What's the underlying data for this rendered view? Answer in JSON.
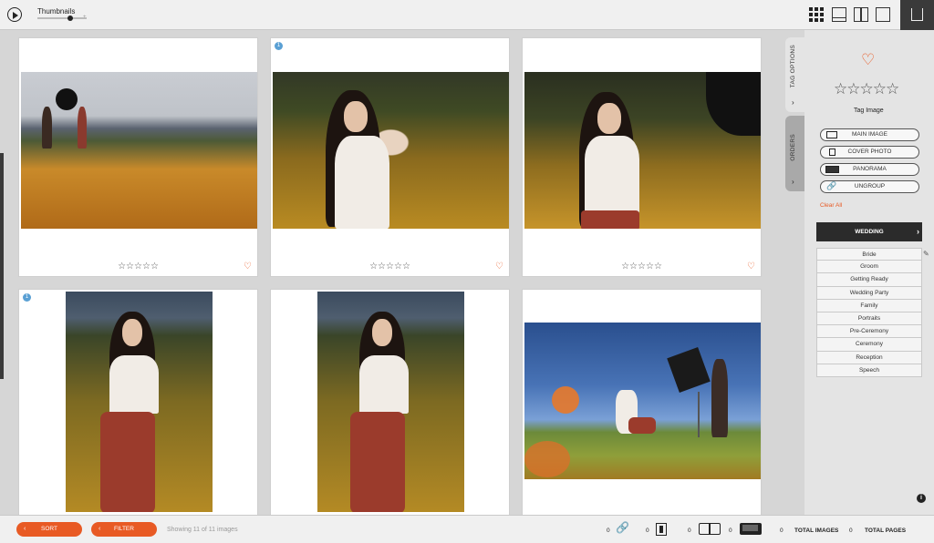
{
  "topbar": {
    "thumbnails_label": "Thumbnails",
    "slider_minus": "−",
    "slider_plus": "+",
    "view_icons": [
      "grid-icon",
      "filmstrip-icon",
      "compare-icon",
      "single-view-icon"
    ],
    "right_icon": "export-icon"
  },
  "grid": {
    "cards": [
      {
        "badge": "",
        "stars": "☆☆☆☆☆",
        "heart": "♡",
        "photo": "field-with-lighting-setup"
      },
      {
        "badge": "1",
        "stars": "☆☆☆☆☆",
        "heart": "♡",
        "photo": "portrait-in-flower-field"
      },
      {
        "badge": "",
        "stars": "☆☆☆☆☆",
        "heart": "♡",
        "photo": "portrait-with-softbox"
      },
      {
        "badge": "1",
        "stars": "",
        "heart": "",
        "photo": "full-length-portrait"
      },
      {
        "badge": "",
        "stars": "",
        "heart": "",
        "photo": "full-length-portrait"
      },
      {
        "badge": "",
        "stars": "",
        "heart": "",
        "photo": "behind-the-scenes-shot"
      }
    ]
  },
  "right_panel": {
    "tabs": [
      {
        "label": "TAG OPTIONS",
        "arrow": "›"
      },
      {
        "label": "ORDERS",
        "arrow": "›"
      }
    ],
    "heart": "♡",
    "stars": "☆☆☆☆☆",
    "tag_image_label": "Tag Image",
    "buttons": [
      {
        "label": "MAIN IMAGE",
        "icon": "main-image-icon"
      },
      {
        "label": "COVER PHOTO",
        "icon": "cover-photo-icon"
      },
      {
        "label": "PANORAMA",
        "icon": "panorama-icon"
      },
      {
        "label": "UNGROUP",
        "icon": "link-icon"
      }
    ],
    "clear_all": "Clear All",
    "category": "WEDDING",
    "category_arrow": "›",
    "tags": [
      "Bride",
      "Groom",
      "Getting Ready",
      "Wedding Party",
      "Family",
      "Portraits",
      "Pre-Ceremony",
      "Ceremony",
      "Reception",
      "Speech"
    ],
    "info": "i"
  },
  "bottombar": {
    "sort_label": "SORT",
    "filter_label": "FILTER",
    "showing_text": "Showing 11 of 11 images",
    "counts": {
      "link": "0",
      "page": "0",
      "book_open": "0",
      "book_full": "0",
      "total_images_count": "0",
      "total_images_label": "TOTAL IMAGES",
      "total_pages_count": "0",
      "total_pages_label": "TOTAL PAGES"
    }
  }
}
